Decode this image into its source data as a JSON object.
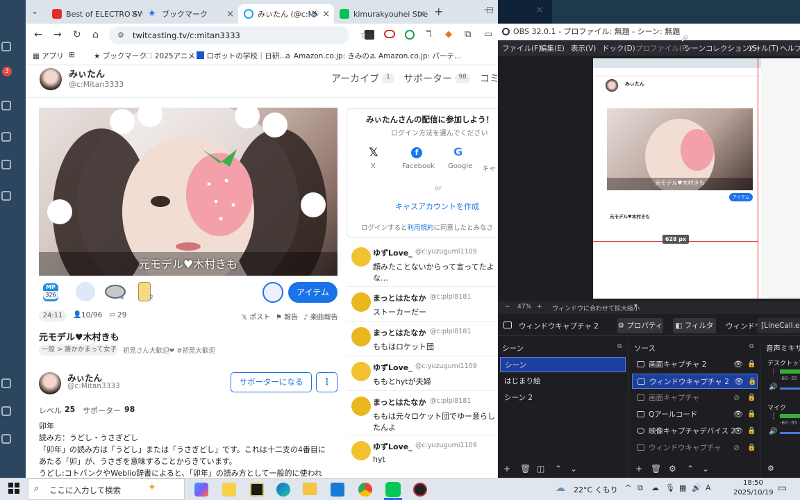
{
  "browser": {
    "tabs": [
      {
        "title": "Best of ELECTRO SW",
        "color": "#e52d27"
      },
      {
        "title": "ブックマーク",
        "color": "#1a73e8"
      },
      {
        "title": "みぃたん (@c:Mi",
        "color": "#1aa7e8"
      },
      {
        "title": "kimurakyouhei Stre",
        "color": "#00c454"
      }
    ],
    "url": "twitcasting.tv/c:mitan3333",
    "bookmarks": [
      "アプリ",
      "ブックマーク",
      "2025アニメ",
      "ロボットの学校｜日研...",
      "Amazon.co.jp: きみの...",
      "Amazon.co.jp: パーテ..."
    ]
  },
  "profile": {
    "name": "みぃたん",
    "handle": "@c:Mitan3333",
    "tabs": [
      {
        "label": "アーカイブ",
        "count": "1"
      },
      {
        "label": "サポーター",
        "count": "98"
      },
      {
        "label": "コミ",
        "count": ""
      }
    ]
  },
  "stream": {
    "overlay_title": "元モデル♥木村きも",
    "mp_label": "MP",
    "mp_value": "326",
    "item_count_1": "4",
    "item_count_2": "2",
    "item_button": "アイテム",
    "duration": "24:11",
    "viewers": "10/96",
    "comments": "29",
    "post": "ポスト",
    "report": "報告",
    "music_report": "楽曲報告",
    "title": "元モデル♥木村きも",
    "category": "一般 > 誰かかまって女子",
    "tags": "初見さん大歓迎❤ #初見大歓迎"
  },
  "streamer": {
    "name": "みぃたん",
    "handle": "@c:Mitan3333",
    "support_button": "サポーターになる",
    "level_label": "レベル",
    "level": "25",
    "supporter_label": "サポーター",
    "supporter": "98",
    "bio": [
      "卯年",
      "読み方：うどし・うさぎどし",
      "「卯年」の読み方は「うどし」または「うさぎどし」です。これは十二支の4番目に",
      "あたる「卯」が、うさぎを意味することからきています。",
      "うどし:コトバンクやWeblio辞書によると、「卯年」の読み方として一般的に使われ"
    ]
  },
  "join": {
    "title": "みぃたんさんの配信に参加しよう！",
    "subtitle": "ログイン方法を選んでください",
    "providers": [
      "X",
      "Facebook",
      "Google",
      "キャ"
    ],
    "or": "or",
    "create": "キャスアカウントを作成",
    "terms_prefix": "ログインすると",
    "terms_link": "利用規約",
    "terms_suffix": "に同意したとみなさ"
  },
  "chat": [
    {
      "name": "ゆずLove_",
      "handle": "@c:yuzugumi1109",
      "text": "顔みたことないからって言ってたよ",
      "text2": "な…",
      "avatar": "yuzu"
    },
    {
      "name": "まっとはたなか",
      "handle": "@c:plpl8181",
      "text": "ストーカーだー",
      "text2": "",
      "avatar": "mat"
    },
    {
      "name": "まっとはたなか",
      "handle": "@c:plpl8181",
      "text": "ももはロケット団",
      "text2": "",
      "avatar": "mat"
    },
    {
      "name": "ゆずLove_",
      "handle": "@c:yuzugumi1109",
      "text": "ももとhytが夫婦",
      "text2": "",
      "avatar": "yuzu"
    },
    {
      "name": "まっとはたなか",
      "handle": "@c:plpl8181",
      "text": "ももは元々ロケット団でゆー意らし",
      "text2": "たんよ",
      "avatar": "mat"
    },
    {
      "name": "ゆずLove_",
      "handle": "@c:yuzugumi1109",
      "text": "hyt",
      "text2": "",
      "avatar": "yuzu"
    }
  ],
  "obs": {
    "title": "OBS 32.0.1 - プロファイル: 無題 - シーン: 無題",
    "menu": [
      "ファイル(F)",
      "編集(E)",
      "表示(V)",
      "ドック(D)",
      "プロファイル(P)",
      "シーンコレクション(S)",
      "ツール(T)",
      "ヘルプ("
    ],
    "preview_size": "628 px",
    "zoom": "47%",
    "zoom_mode": "ウィンドウに合わせて拡大縮小",
    "selected_source": "ウィンドウキャプチャ 2",
    "properties": "プロパティ",
    "filters": "フィルタ",
    "window_label": "ウィンドウ",
    "window_value": "[LineCall.exe",
    "scenes_header": "シーン",
    "sources_header": "ソース",
    "mixer_header": "音声ミキサー",
    "scenes": [
      "シーン",
      "はじまり絵",
      "シーン 2"
    ],
    "sources": [
      "画面キャプチャ 2",
      "ウィンドウキャプチャ 2",
      "画面キャプチャ",
      "Qアールコード",
      "映像キャプチャデバイス 2",
      "ウィンドウキャプチャ"
    ],
    "mixer": [
      "デスクトップ音",
      "マイク"
    ],
    "db_a": "-60",
    "db_b": "-55"
  },
  "preview": {
    "name": "みぃたん",
    "overlay": "元モデル♥木村きも",
    "item": "アイテム",
    "title": "元モデル♥木村きも"
  },
  "taskbar": {
    "search_placeholder": "ここに入力して検索",
    "weather": "22°C くもり",
    "time": "18:50",
    "date": "2025/10/19",
    "ime": "A"
  },
  "colors": {
    "accent": "#1a73e8",
    "obs_bg": "#1e1e22",
    "select": "#1d3f9e"
  }
}
